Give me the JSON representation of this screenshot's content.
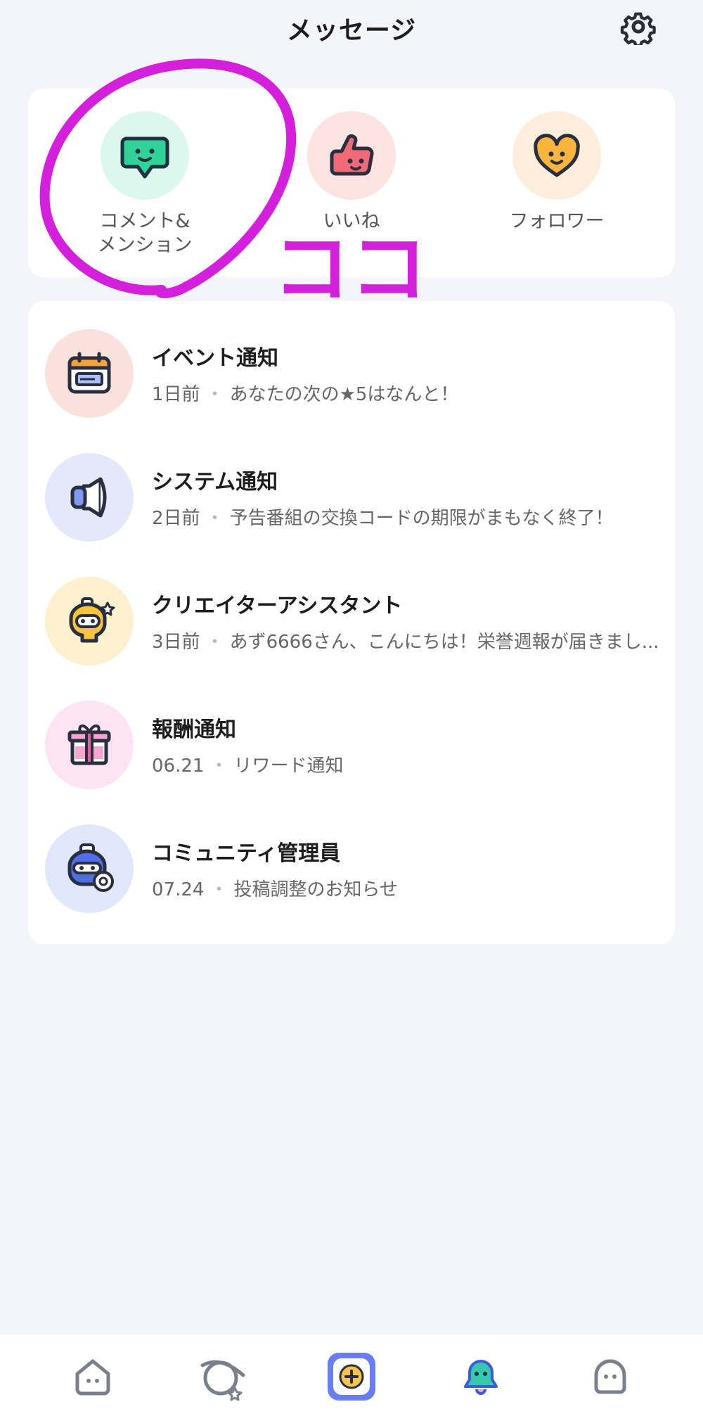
{
  "header": {
    "title": "メッセージ"
  },
  "categories": [
    {
      "label": "コメント&\nメンション",
      "icon": "speech-bubble-icon",
      "bg": "#dcf7ee"
    },
    {
      "label": "いいね",
      "icon": "thumbs-up-icon",
      "bg": "#fde2e2"
    },
    {
      "label": "フォロワー",
      "icon": "heart-icon",
      "bg": "#fdeedb"
    }
  ],
  "notifications": [
    {
      "title": "イベント通知",
      "time": "1日前",
      "preview": "あなたの次の★5はなんと！",
      "icon": "calendar-icon",
      "bg": "#fbe1dc"
    },
    {
      "title": "システム通知",
      "time": "2日前",
      "preview": "予告番組の交換コードの期限がまもなく終了！",
      "icon": "speaker-icon",
      "bg": "#e3e8fb"
    },
    {
      "title": "クリエイターアシスタント",
      "time": "3日前",
      "preview": "あず6666さん、こんにちは！栄誉週報が届きまし...",
      "icon": "assistant-robot-icon",
      "bg": "#fdf0cc"
    },
    {
      "title": "報酬通知",
      "time": "06.21",
      "preview": "リワード通知",
      "icon": "gift-icon",
      "bg": "#fde3f3"
    },
    {
      "title": "コミュニティ管理員",
      "time": "07.24",
      "preview": "投稿調整のお知らせ",
      "icon": "moderator-robot-icon",
      "bg": "#e0e6fb"
    }
  ],
  "annotation": {
    "text": "ココ",
    "color": "#d41fdc"
  },
  "tabs": [
    "home-icon",
    "planet-icon",
    "create-plus-icon",
    "messages-bell-icon",
    "profile-ghost-icon"
  ]
}
